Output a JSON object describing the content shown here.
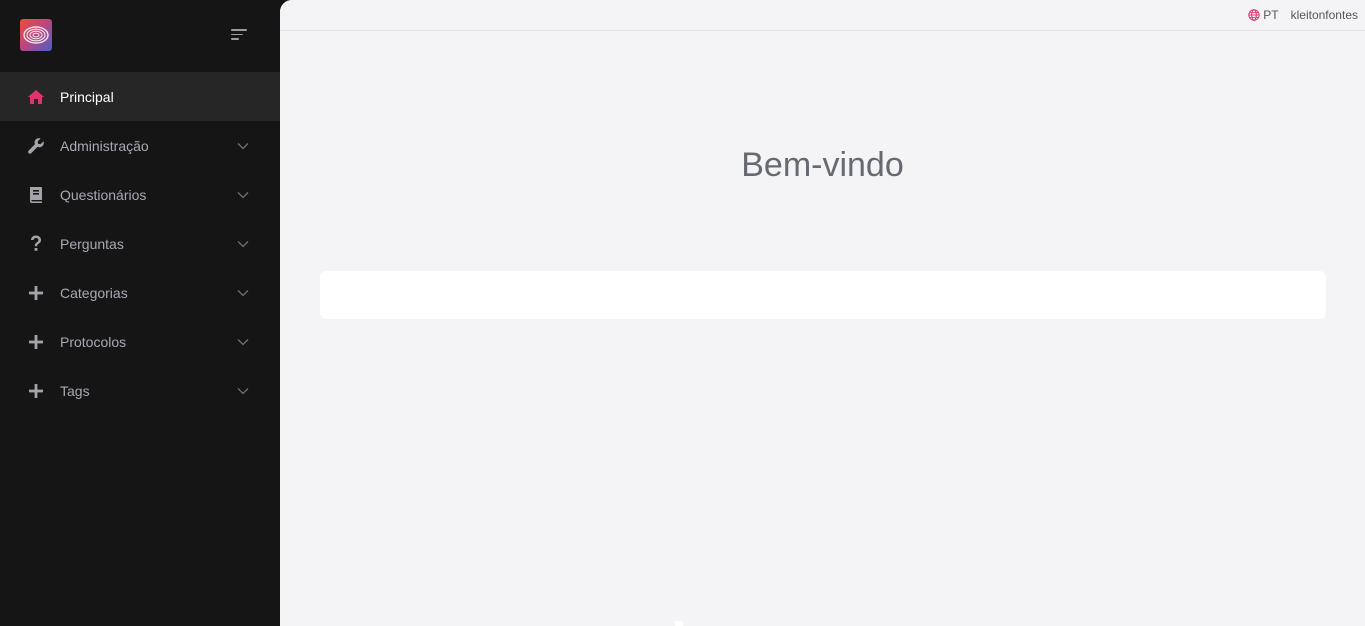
{
  "sidebar": {
    "logo_icon": "fingerprint-logo",
    "toggle_icon": "menu-lines-icon",
    "items": [
      {
        "label": "Principal",
        "icon": "home-icon",
        "active": true,
        "expandable": false
      },
      {
        "label": "Administração",
        "icon": "wrench-icon",
        "active": false,
        "expandable": true
      },
      {
        "label": "Questionários",
        "icon": "book-icon",
        "active": false,
        "expandable": true
      },
      {
        "label": "Perguntas",
        "icon": "question-icon",
        "active": false,
        "expandable": true
      },
      {
        "label": "Categorias",
        "icon": "plus-icon",
        "active": false,
        "expandable": true
      },
      {
        "label": "Protocolos",
        "icon": "plus-icon",
        "active": false,
        "expandable": true
      },
      {
        "label": "Tags",
        "icon": "plus-icon",
        "active": false,
        "expandable": true
      }
    ]
  },
  "header": {
    "language": "PT",
    "language_icon": "globe-icon",
    "username": "kleitonfontes"
  },
  "main": {
    "title": "Bem-vindo"
  },
  "colors": {
    "sidebar_bg": "#151515",
    "active_item_bg": "#262626",
    "accent": "#e0326d",
    "content_bg": "#f4f4f6"
  }
}
